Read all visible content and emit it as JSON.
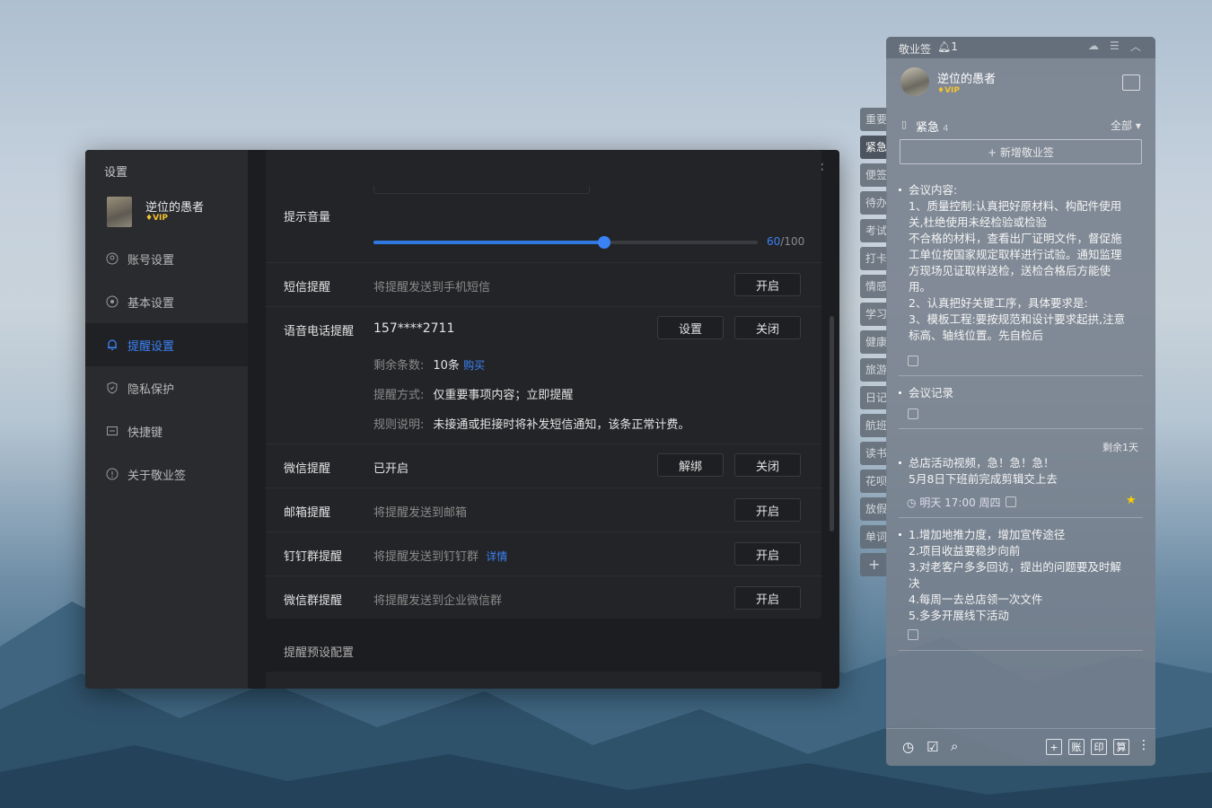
{
  "settings": {
    "title": "设置",
    "user": {
      "name": "逆位的愚者",
      "badge": "VIP"
    },
    "nav": [
      {
        "label": "账号设置",
        "icon": "user-circle-icon"
      },
      {
        "label": "基本设置",
        "icon": "gear-icon"
      },
      {
        "label": "提醒设置",
        "icon": "bell-icon"
      },
      {
        "label": "隐私保护",
        "icon": "shield-icon"
      },
      {
        "label": "快捷键",
        "icon": "keyboard-icon"
      },
      {
        "label": "关于敬业签",
        "icon": "info-icon"
      }
    ],
    "volume": {
      "label": "提示音量",
      "value": "60",
      "max": "/100",
      "fraction": 0.6
    },
    "rows": {
      "sms": {
        "label": "短信提醒",
        "desc": "将提醒发送到手机短信",
        "btn": "开启"
      },
      "voice": {
        "label": "语音电话提醒",
        "value": "157****2711",
        "btn1": "设置",
        "btn2": "关闭",
        "remain_label": "剩余条数:",
        "remain_value": "10条",
        "buy": "购买",
        "mode_label": "提醒方式:",
        "mode_value": "仅重要事项内容；立即提醒",
        "rule_label": "规则说明:",
        "rule_value": "未接通或拒接时将补发短信通知，该条正常计费。"
      },
      "wechat": {
        "label": "微信提醒",
        "value": "已开启",
        "btn1": "解绑",
        "btn2": "关闭"
      },
      "email": {
        "label": "邮箱提醒",
        "desc": "将提醒发送到邮箱",
        "btn": "开启"
      },
      "dingtalk": {
        "label": "钉钉群提醒",
        "desc": "将提醒发送到钉钉群",
        "link": "详情",
        "btn": "开启"
      },
      "wecom": {
        "label": "微信群提醒",
        "desc": "将提醒发送到企业微信群",
        "btn": "开启"
      }
    },
    "section2": "提醒预设配置"
  },
  "notes": {
    "app": "敬业签",
    "bell_count": "1",
    "user": {
      "name": "逆位的愚者",
      "badge": "VIP"
    },
    "category": {
      "name": "紧急",
      "count": "4",
      "filter": "全部"
    },
    "new_button": "+ 新增敬业签",
    "tabs": [
      "重要",
      "紧急",
      "便签",
      "待办",
      "考试",
      "打卡",
      "情感",
      "学习",
      "健康",
      "旅游",
      "日记",
      "航班",
      "读书",
      "花呗",
      "放假",
      "单词"
    ],
    "items": [
      {
        "lines": [
          "会议内容:",
          "1、质量控制:认真把好原材料、构配件使用",
          "关,杜绝使用未经检验或检验",
          "不合格的材料，查看出厂证明文件，督促施",
          "工单位按国家规定取样进行试验。通知监理",
          "方现场见证取样送检，送检合格后方能使",
          "用。",
          "2、认真把好关键工序，具体要求是:",
          "3、模板工程:要按规范和设计要求起拱,注意",
          "标高、轴线位置。先自检后"
        ]
      },
      {
        "lines": [
          "会议记录"
        ]
      },
      {
        "remaining": "剩余1天",
        "lines": [
          "总店活动视频，急！急！急！",
          "5月8日下班前完成剪辑交上去"
        ],
        "time": "明天 17:00 周四"
      },
      {
        "lines": [
          "1.增加地推力度，增加宣传途径",
          "2.项目收益要稳步向前",
          "3.对老客户多多回访，提出的问题要及时解",
          "决",
          "4.每周一去总店领一次文件",
          "5.多多开展线下活动"
        ]
      }
    ],
    "toolbar": [
      "账",
      "印",
      "算"
    ]
  }
}
